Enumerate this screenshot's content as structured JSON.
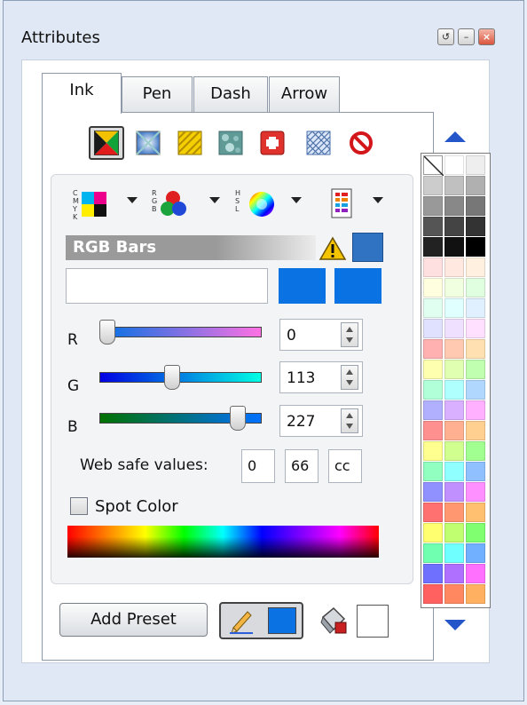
{
  "window": {
    "title": "Attributes",
    "buttons": {
      "restore": "↺",
      "minimize": "–",
      "close": "×"
    }
  },
  "tabs": [
    {
      "label": "Ink",
      "active": true
    },
    {
      "label": "Pen",
      "active": false
    },
    {
      "label": "Dash",
      "active": false
    },
    {
      "label": "Arrow",
      "active": false
    }
  ],
  "fill_types": [
    {
      "name": "solid-fill",
      "selected": true
    },
    {
      "name": "gradient-fill",
      "selected": false
    },
    {
      "name": "pattern-fill",
      "selected": false
    },
    {
      "name": "texture-fill",
      "selected": false
    },
    {
      "name": "image-fill",
      "selected": false
    },
    {
      "name": "hatch-fill",
      "selected": false
    },
    {
      "name": "no-fill",
      "selected": false
    }
  ],
  "color_models": [
    "CMYK",
    "RGB",
    "HSL",
    "Palette"
  ],
  "color_editor": {
    "mode_label": "RGB Bars",
    "hex_value": "",
    "channels": [
      {
        "label": "R",
        "value": "0",
        "fraction": 0.0
      },
      {
        "label": "G",
        "value": "113",
        "fraction": 0.443
      },
      {
        "label": "B",
        "value": "227",
        "fraction": 0.89
      }
    ],
    "web_safe_label": "Web safe values:",
    "web_safe": [
      "0",
      "66",
      "cc"
    ],
    "spot_color_label": "Spot Color",
    "spot_color_checked": false,
    "current_color": "#0a72e3"
  },
  "footer": {
    "add_preset_label": "Add Preset"
  },
  "colors": {
    "accent": "#0a72e3",
    "warning": "#f5c400"
  },
  "palette_rows": [
    [
      "none",
      "#ffffff",
      "#eeeeee"
    ],
    [
      "#cccccc",
      "#c0c0c0",
      "#b0b0b0"
    ],
    [
      "#999999",
      "#888888",
      "#777777"
    ],
    [
      "#555555",
      "#444444",
      "#333333"
    ],
    [
      "#222222",
      "#111111",
      "#000000"
    ],
    [
      "#ffe0e0",
      "#ffe8e0",
      "#fff0e0"
    ],
    [
      "#ffffe0",
      "#f0ffe0",
      "#e0ffe0"
    ],
    [
      "#e0fff0",
      "#e0ffff",
      "#e0f0ff"
    ],
    [
      "#e0e0ff",
      "#f0e0ff",
      "#ffe0ff"
    ],
    [
      "#ffb0b0",
      "#ffc8b0",
      "#ffe0b0"
    ],
    [
      "#ffffb0",
      "#e0ffb0",
      "#c0ffb0"
    ],
    [
      "#b0ffd8",
      "#b0ffff",
      "#b0d8ff"
    ],
    [
      "#b0b0ff",
      "#d8b0ff",
      "#ffb0ff"
    ],
    [
      "#ff9090",
      "#ffb090",
      "#ffd090"
    ],
    [
      "#ffff90",
      "#d0ff90",
      "#a0ff90"
    ],
    [
      "#90ffc0",
      "#90ffff",
      "#90c0ff"
    ],
    [
      "#9090ff",
      "#c090ff",
      "#ff90ff"
    ],
    [
      "#ff7070",
      "#ff9870",
      "#ffc070"
    ],
    [
      "#ffff70",
      "#c0ff70",
      "#80ff70"
    ],
    [
      "#70ffb0",
      "#70ffff",
      "#70b0ff"
    ],
    [
      "#7070ff",
      "#b070ff",
      "#ff70ff"
    ],
    [
      "#ff6060",
      "#ff8860",
      "#ffb060"
    ]
  ]
}
